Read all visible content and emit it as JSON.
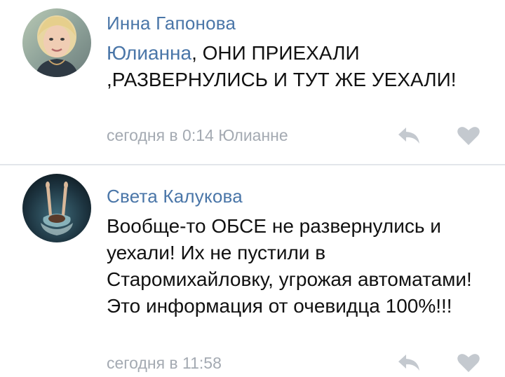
{
  "comments": [
    {
      "author": "Инна Гапонова",
      "reply_to": "Юлианна",
      "text": ", ОНИ ПРИЕХАЛИ ,РАЗВЕРНУЛИСЬ И ТУТ ЖЕ УЕХАЛИ!",
      "meta": "сегодня в 0:14 Юлианне",
      "reply_icon": "reply-arrow",
      "like_icon": "heart"
    },
    {
      "author": "Света Калукова",
      "text": "Вообще-то ОБСЕ не развернулись и уехали! Их не пустили в Старомихайловку, угрожая автоматами! Это информация от очевидца 100%!!!",
      "meta": "сегодня в 11:58",
      "reply_icon": "reply-arrow",
      "like_icon": "heart"
    }
  ],
  "colors": {
    "author": "#4a76a8",
    "text": "#111111",
    "meta": "#a4aab2",
    "icon": "#c4c9cf",
    "divider": "#e3e6ea"
  }
}
